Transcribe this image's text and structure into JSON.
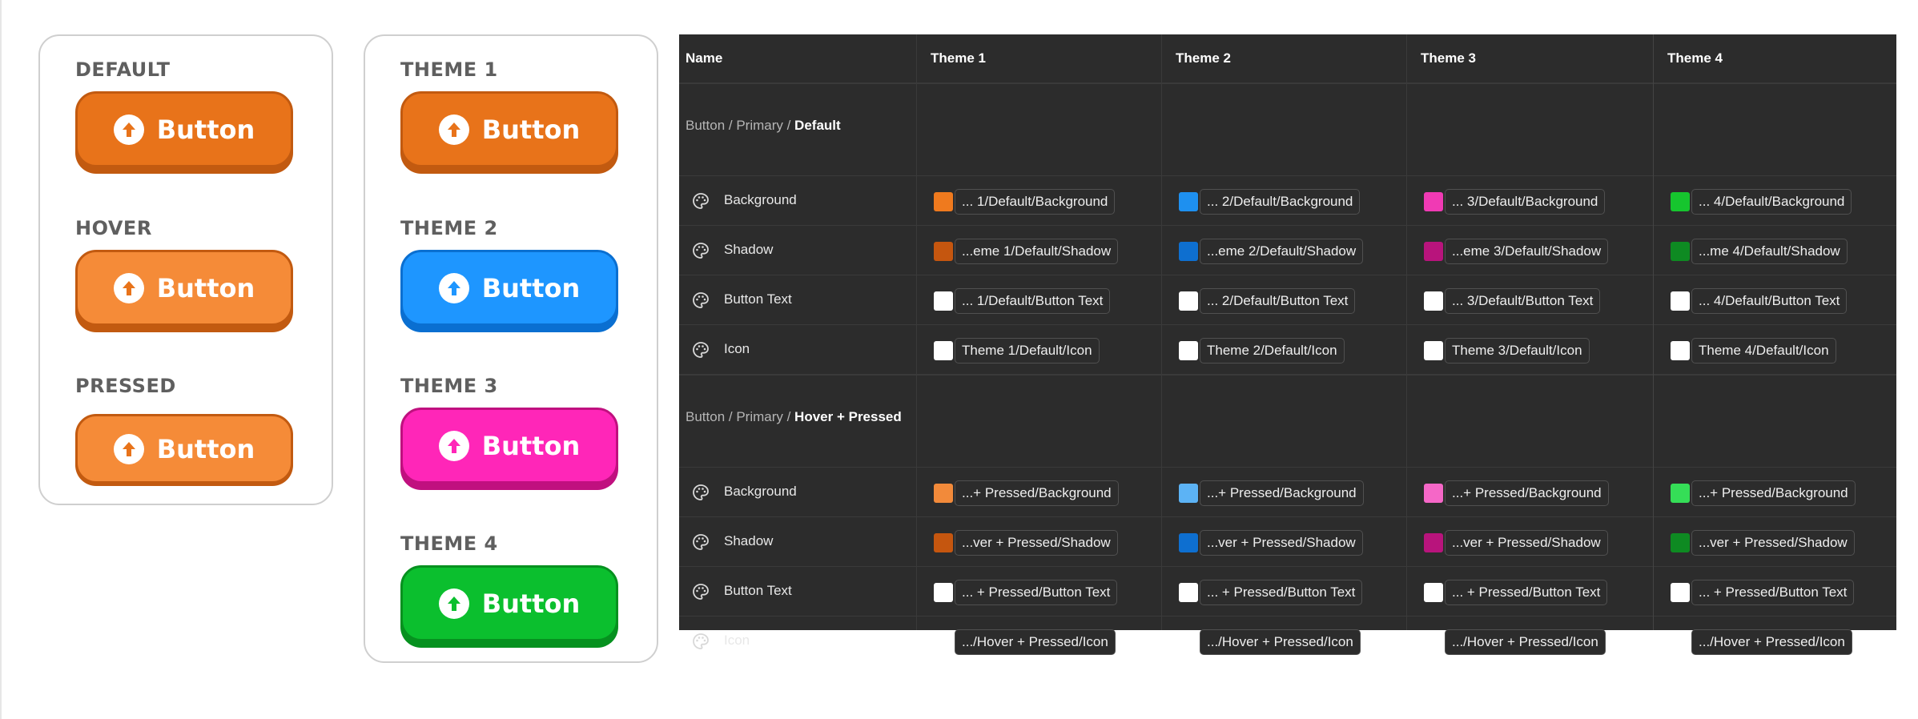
{
  "state_card": {
    "groups": [
      {
        "label": "DEFAULT",
        "button_text": "Button",
        "fill": "#e8731a",
        "rim": "#c25a10"
      },
      {
        "label": "HOVER",
        "button_text": "Button",
        "fill": "#f58b38",
        "rim": "#c25a10"
      },
      {
        "label": "PRESSED",
        "button_text": "Button",
        "fill": "#f58b38",
        "rim": "#c25a10"
      }
    ]
  },
  "theme_card": {
    "groups": [
      {
        "label": "THEME 1",
        "button_text": "Button",
        "fill": "#e8731a",
        "rim": "#c25a10"
      },
      {
        "label": "THEME 2",
        "button_text": "Button",
        "fill": "#1e96ff",
        "rim": "#0a6fd1"
      },
      {
        "label": "THEME 3",
        "button_text": "Button",
        "fill": "#ff26b8",
        "rim": "#c0107f"
      },
      {
        "label": "THEME 4",
        "button_text": "Button",
        "fill": "#0bbf2e",
        "rim": "#06911f"
      }
    ]
  },
  "table": {
    "headers": [
      "Name",
      "Theme 1",
      "Theme 2",
      "Theme 3",
      "Theme 4"
    ],
    "sections": [
      {
        "path_prefix": "Button / Primary / ",
        "title": "Default",
        "rows": [
          {
            "name": "Background",
            "tokens": [
              "... 1/Default/Background",
              "... 2/Default/Background",
              "... 3/Default/Background",
              "... 4/Default/Background"
            ],
            "swatches": [
              "#ef7a1e",
              "#1e90f0",
              "#f03ab4",
              "#16c52e"
            ]
          },
          {
            "name": "Shadow",
            "tokens": [
              "...eme 1/Default/Shadow",
              "...eme 2/Default/Shadow",
              "...eme 3/Default/Shadow",
              "...me 4/Default/Shadow"
            ],
            "swatches": [
              "#c5560f",
              "#0e6fd0",
              "#b8147c",
              "#0e8a22"
            ]
          },
          {
            "name": "Button Text",
            "tokens": [
              "... 1/Default/Button Text",
              "... 2/Default/Button Text",
              "... 3/Default/Button Text",
              "... 4/Default/Button Text"
            ],
            "swatches": [
              "#ffffff",
              "#ffffff",
              "#ffffff",
              "#ffffff"
            ]
          },
          {
            "name": "Icon",
            "tokens": [
              "Theme 1/Default/Icon",
              "Theme 2/Default/Icon",
              "Theme 3/Default/Icon",
              "Theme 4/Default/Icon"
            ],
            "swatches": [
              "#ffffff",
              "#ffffff",
              "#ffffff",
              "#ffffff"
            ]
          }
        ]
      },
      {
        "path_prefix": "Button / Primary / ",
        "title": "Hover + Pressed",
        "rows": [
          {
            "name": "Background",
            "tokens": [
              "...+ Pressed/Background",
              "...+ Pressed/Background",
              "...+ Pressed/Background",
              "...+ Pressed/Background"
            ],
            "swatches": [
              "#f28a3a",
              "#5cb3f5",
              "#f567c7",
              "#35de57"
            ]
          },
          {
            "name": "Shadow",
            "tokens": [
              "...ver + Pressed/Shadow",
              "...ver + Pressed/Shadow",
              "...ver + Pressed/Shadow",
              "...ver + Pressed/Shadow"
            ],
            "swatches": [
              "#c5560f",
              "#0e6fd0",
              "#b8147c",
              "#0e8a22"
            ]
          },
          {
            "name": "Button Text",
            "tokens": [
              "... + Pressed/Button Text",
              "... + Pressed/Button Text",
              "... + Pressed/Button Text",
              "... + Pressed/Button Text"
            ],
            "swatches": [
              "#ffffff",
              "#ffffff",
              "#ffffff",
              "#ffffff"
            ]
          },
          {
            "name": "Icon",
            "tokens": [
              ".../Hover + Pressed/Icon",
              ".../Hover + Pressed/Icon",
              ".../Hover + Pressed/Icon",
              ".../Hover + Pressed/Icon"
            ],
            "swatches": [
              "#ffffff",
              "#ffffff",
              "#ffffff",
              "#ffffff"
            ]
          }
        ]
      }
    ]
  }
}
